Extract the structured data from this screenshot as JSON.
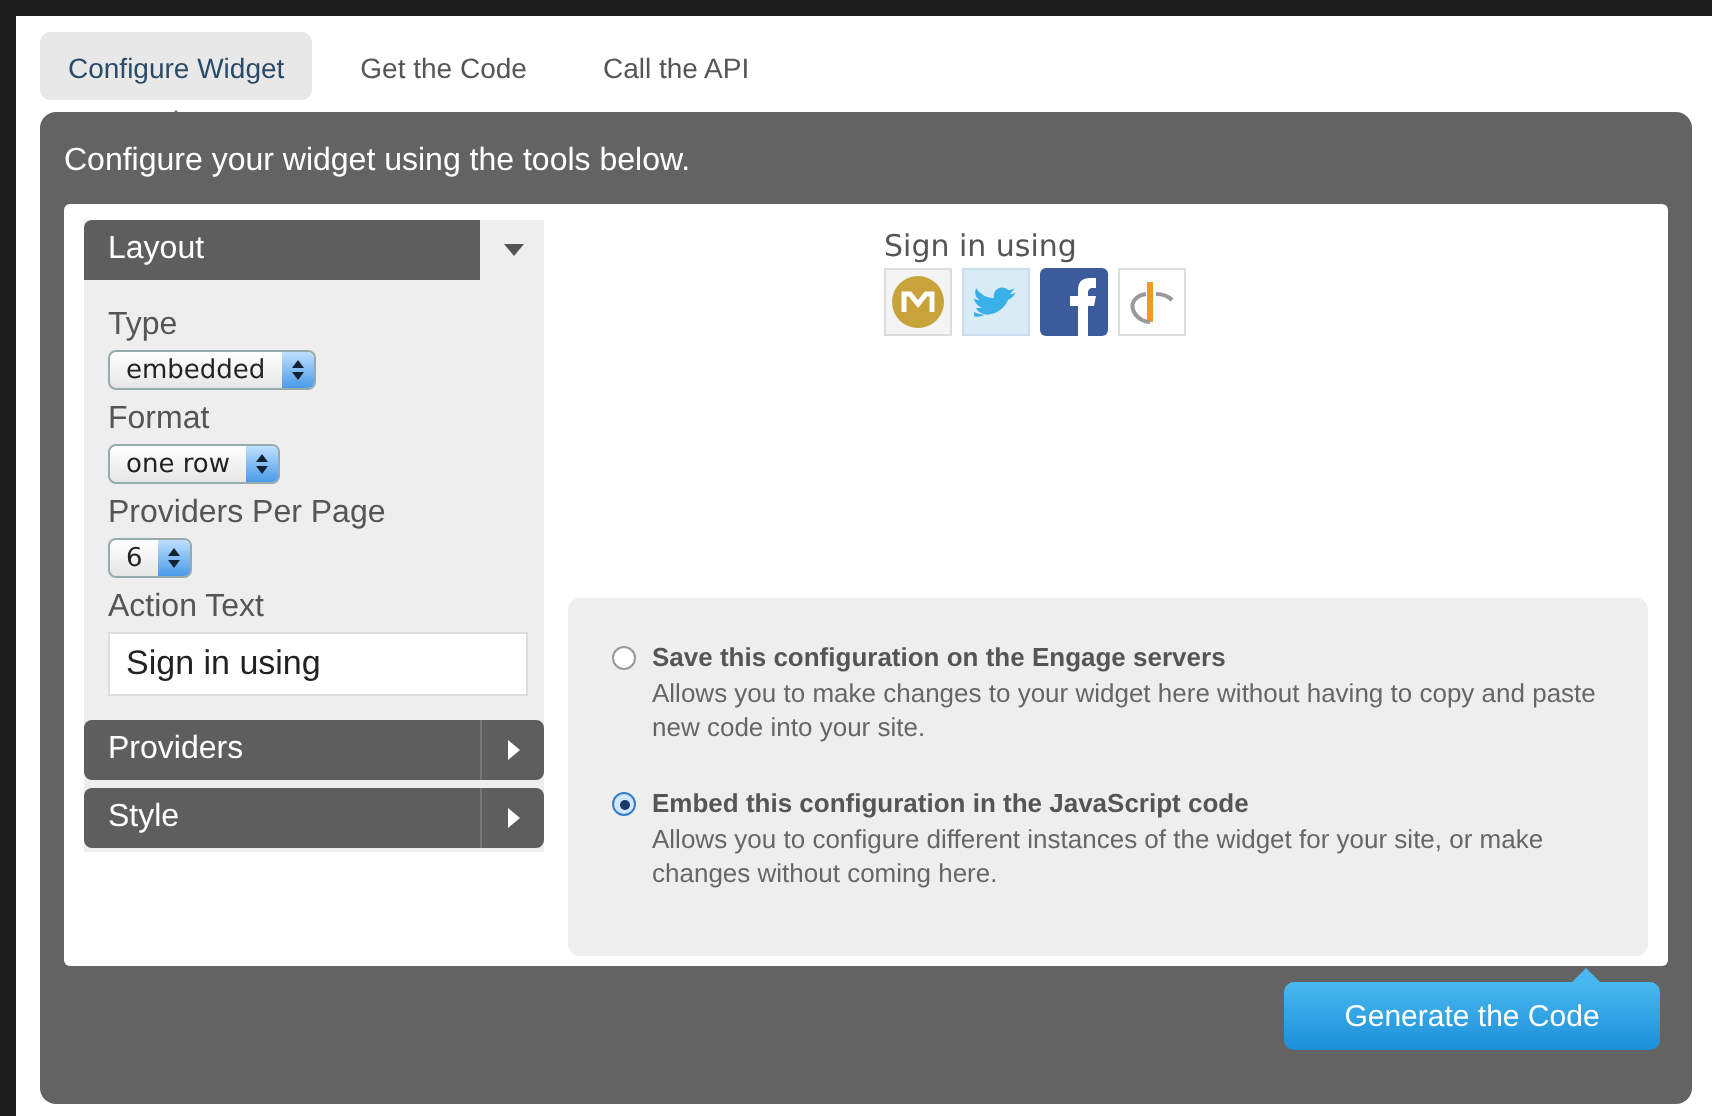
{
  "tabs": [
    {
      "label": "Configure Widget",
      "selected": true
    },
    {
      "label": "Get the Code",
      "selected": false
    },
    {
      "label": "Call the API",
      "selected": false
    }
  ],
  "panel": {
    "heading": "Configure your widget using the tools below."
  },
  "sidebar": {
    "sections": [
      {
        "title": "Layout",
        "expanded": true,
        "fields": [
          {
            "kind": "select",
            "label": "Type",
            "value": "embedded"
          },
          {
            "kind": "select",
            "label": "Format",
            "value": "one row"
          },
          {
            "kind": "select",
            "label": "Providers Per Page",
            "value": "6"
          },
          {
            "kind": "text",
            "label": "Action Text",
            "value": "Sign in using"
          }
        ]
      },
      {
        "title": "Providers",
        "expanded": false
      },
      {
        "title": "Style",
        "expanded": false
      }
    ]
  },
  "preview": {
    "action_text": "Sign in using"
  },
  "options": [
    {
      "title": "Save this configuration on the Engage servers",
      "description": "Allows you to make changes to your widget here without having to copy and paste new code into your site.",
      "selected": false
    },
    {
      "title": "Embed this configuration in the JavaScript code",
      "description": "Allows you to configure different instances of the widget for your site, or make changes without coming here.",
      "selected": true
    }
  ],
  "button": "Generate the Code"
}
